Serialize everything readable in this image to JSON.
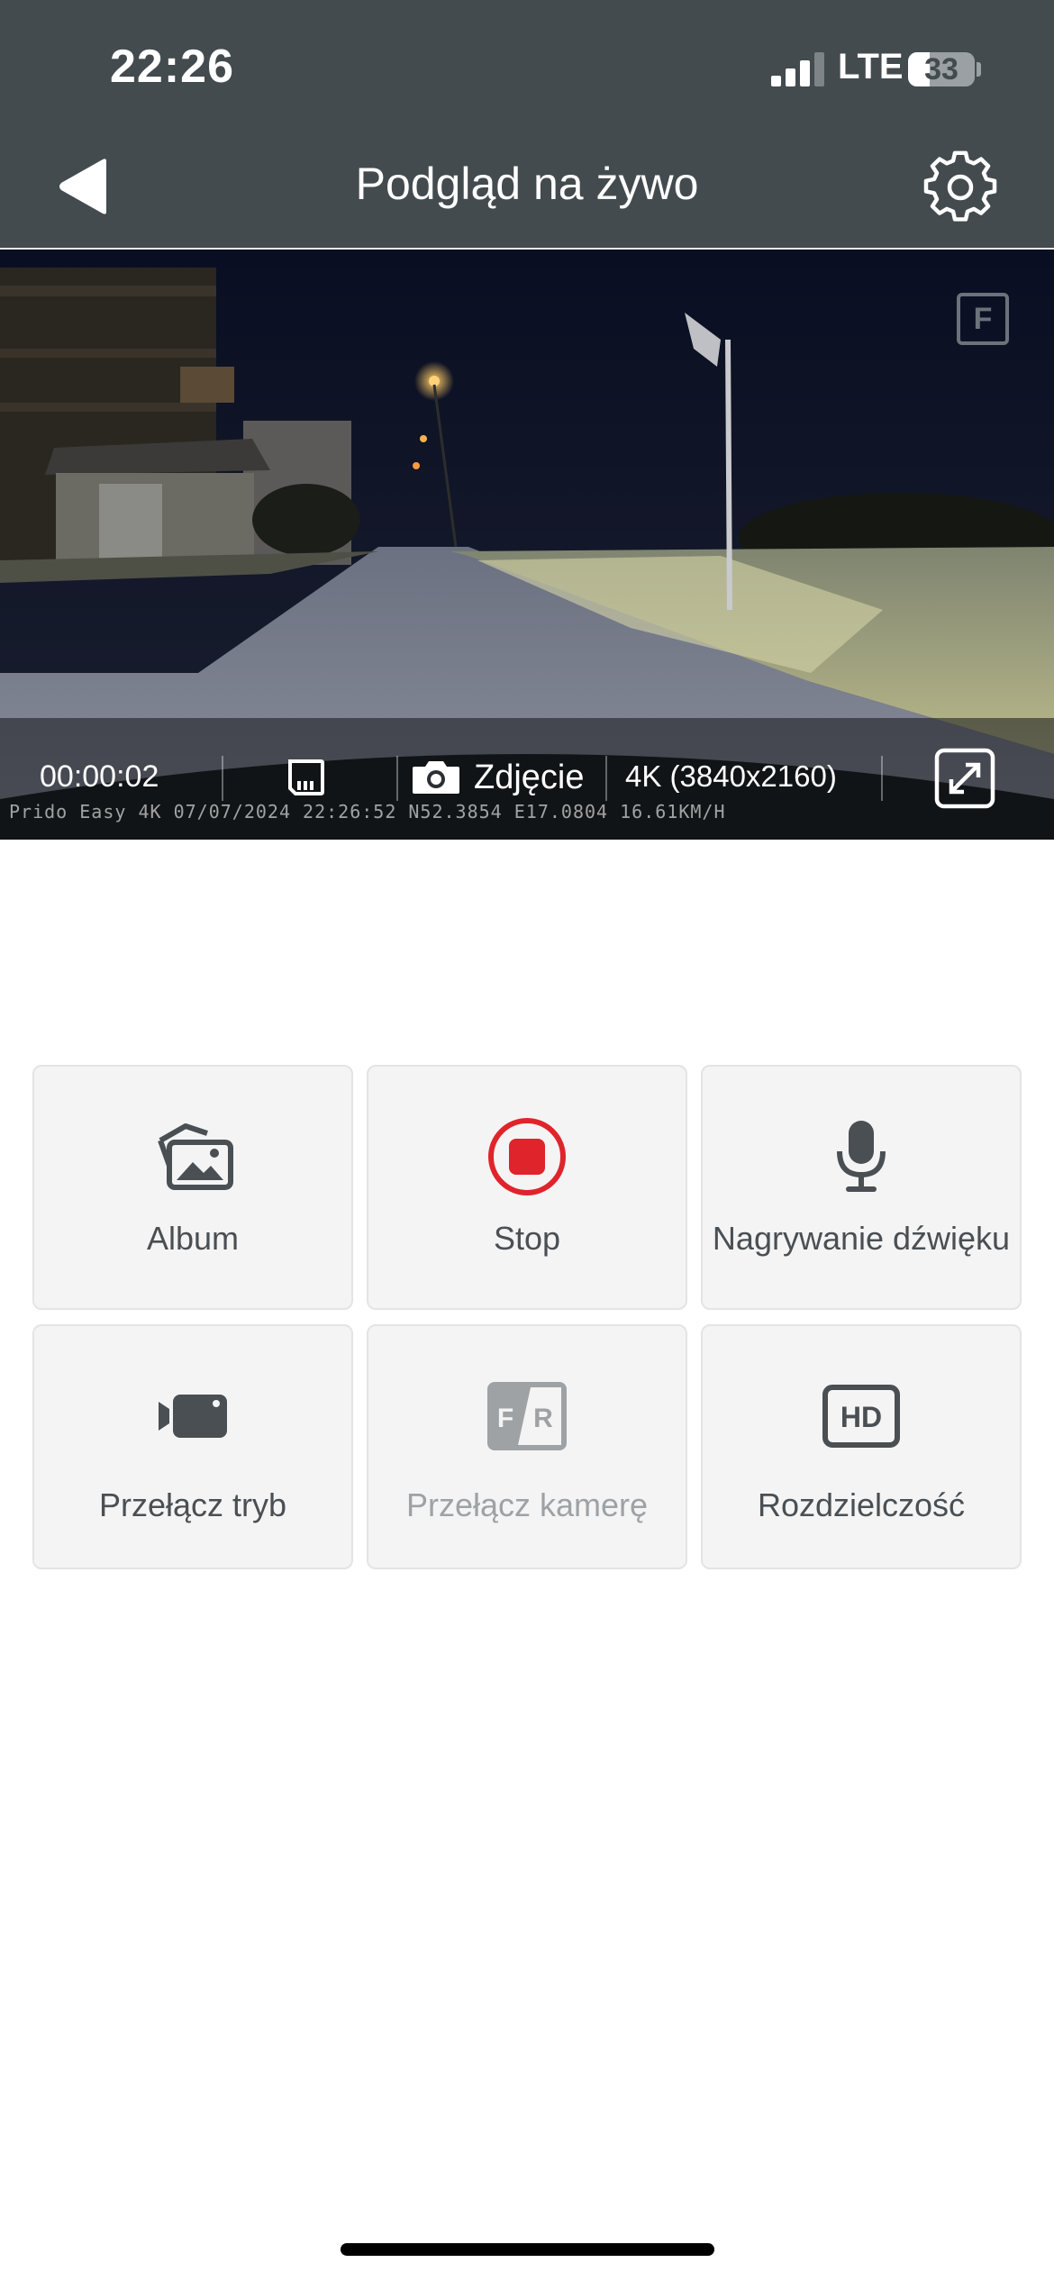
{
  "status_bar": {
    "time": "22:26",
    "network": "LTE",
    "battery_level": "33",
    "battery_fraction": 0.33,
    "signal_bars_active": 3,
    "signal_bars_total": 4
  },
  "nav": {
    "title": "Podgląd na żywo",
    "back_icon": "back-arrow-icon",
    "settings_icon": "gear-icon"
  },
  "preview": {
    "camera_badge": "F",
    "recording_time": "00:00:02",
    "sd_icon": "sd-card-icon",
    "photo_label": "Zdjęcie",
    "resolution": "4K (3840x2160)",
    "watermark": "Prido Easy 4K 07/07/2024 22:26:52 N52.3854 E17.0804 16.61KM/H",
    "fullscreen_icon": "fullscreen-icon"
  },
  "controls": [
    {
      "label": "Album",
      "icon": "album-icon",
      "enabled": true
    },
    {
      "label": "Stop",
      "icon": "record-stop-icon",
      "enabled": true
    },
    {
      "label": "Nagrywanie dźwięku",
      "icon": "microphone-icon",
      "enabled": true
    },
    {
      "label": "Przełącz tryb",
      "icon": "video-camera-icon",
      "enabled": true
    },
    {
      "label": "Przełącz kamerę",
      "icon": "front-rear-camera-icon",
      "enabled": false
    },
    {
      "label": "Rozdzielczość",
      "icon": "hd-icon",
      "enabled": true
    }
  ],
  "colors": {
    "header_bg": "#434b4f",
    "accent_red": "#e0242b",
    "tile_bg": "#f4f4f4",
    "text_gray": "#4a4f53",
    "disabled_gray": "#9ea2a5"
  }
}
